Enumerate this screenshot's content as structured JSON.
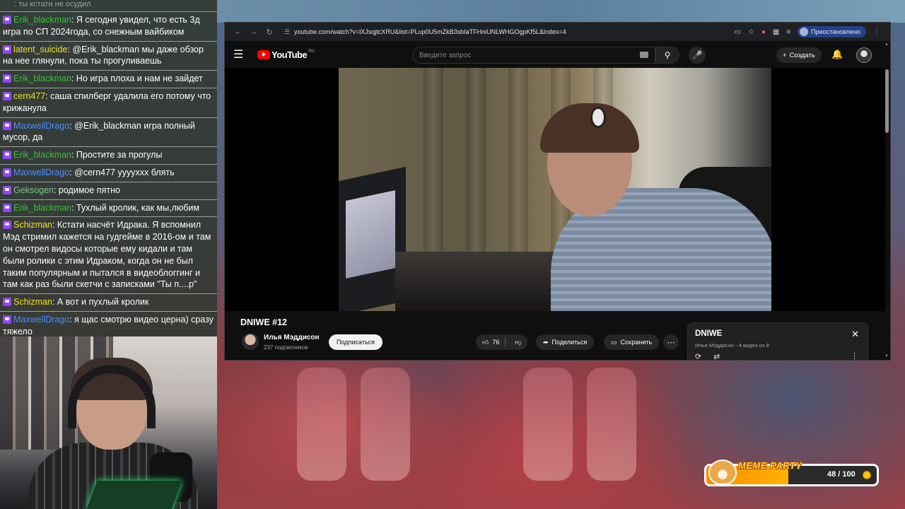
{
  "chat": {
    "top_partial": ": ты кстати не осудил",
    "messages": [
      {
        "user": "Erik_blackman",
        "color": "#3bbf3b",
        "text": ": Я сегодня увидел, что есть 3д игра по СП 2024года, со снежным вайбиком"
      },
      {
        "user": "latent_suicide",
        "color": "#f2e21d",
        "text": ": @Erik_blackman мы даже обзор на нее глянули, пока ты прогуливаешь"
      },
      {
        "user": "Erik_blackman",
        "color": "#3bbf3b",
        "text": ": Но игра плоха и нам не зайдет"
      },
      {
        "user": "cern477",
        "color": "#f2e21d",
        "text": ": саша спилберг удалила его потому что крижанула"
      },
      {
        "user": "MaxwellDrago",
        "color": "#4a8cff",
        "text": ": @Erik_blackman игра полный мусор, да"
      },
      {
        "user": "Erik_blackman",
        "color": "#3bbf3b",
        "text": ": Простите за прогулы"
      },
      {
        "user": "MaxwellDrago",
        "color": "#4a8cff",
        "text": ": @cern477 ууууххх блять"
      },
      {
        "user": "Geksogen",
        "color": "#7ac98a",
        "text": ": родимое пятно"
      },
      {
        "user": "Erik_blackman",
        "color": "#3bbf3b",
        "text": ": Тухлый кролик, как мы,любим"
      },
      {
        "user": "Schizman",
        "color": "#f2e21d",
        "text": ": Кстати насчёт Идрака. Я вспомнил Мэд стримил кажется на гудгейме в 2016-ом и там он смотрел видосы которые ему кидали и там были ролики с этим Идраком, когда он не был таким популярным и пытался в видеоблоггинг и там как раз были скетчи с записками \"Ты п....р\""
      },
      {
        "user": "Schizman",
        "color": "#f2e21d",
        "text": ": А вот и пухлый кролик"
      },
      {
        "user": "MaxwellDrago",
        "color": "#4a8cff",
        "text": ": я щас смотрю видео церна) сразу тяжело"
      }
    ]
  },
  "browser": {
    "url": "youtube.com/watch?v=lXJsqjtcXRU&list=PLup0U5mZkB3sbIaTFHniUNLWHGOgpKf5L&index=4",
    "profile_label": "Приостановлено"
  },
  "youtube": {
    "logo_text": "YouTube",
    "logo_region": "RU",
    "search_placeholder": "Введите запрос",
    "create_label": "Создать",
    "video_title": "DNIWE #12",
    "channel_name": "Илья Мэддисон",
    "subscribers": "237 подписчиков",
    "subscribe_label": "Подписаться",
    "likes": "76",
    "share_label": "Поделиться",
    "save_label": "Сохранить",
    "playlist": {
      "title": "DNIWE",
      "subtitle": "Илья Мэддисон - 4 видео из 8"
    }
  },
  "meme_party": {
    "title": "MEME PARTY",
    "count_label": "48 / 100",
    "progress": 0.48
  }
}
